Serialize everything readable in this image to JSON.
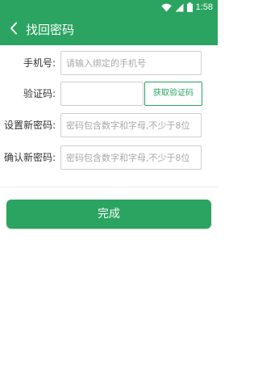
{
  "status_bar": {
    "time": "1:58",
    "icons": [
      "wifi-icon",
      "cell-signal-icon",
      "battery-icon"
    ]
  },
  "app_bar": {
    "back_icon": "chevron-left-icon",
    "title": "找回密码"
  },
  "form": {
    "phone": {
      "label": "手机号:",
      "placeholder": "请输入绑定的手机号",
      "value": ""
    },
    "code": {
      "label": "验证码:",
      "placeholder": "",
      "value": "",
      "button_label": "获取验证码"
    },
    "new_password": {
      "label": "设置新密码:",
      "placeholder": "密码包含数字和字母,不少于8位",
      "value": ""
    },
    "confirm_password": {
      "label": "确认新密码:",
      "placeholder": "密码包含数字和字母,不少于8位",
      "value": ""
    }
  },
  "submit_label": "完成",
  "colors": {
    "primary": "#2aa460",
    "input_border": "#cfcfcf",
    "placeholder": "#a8a8a8",
    "label_text": "#333333"
  }
}
